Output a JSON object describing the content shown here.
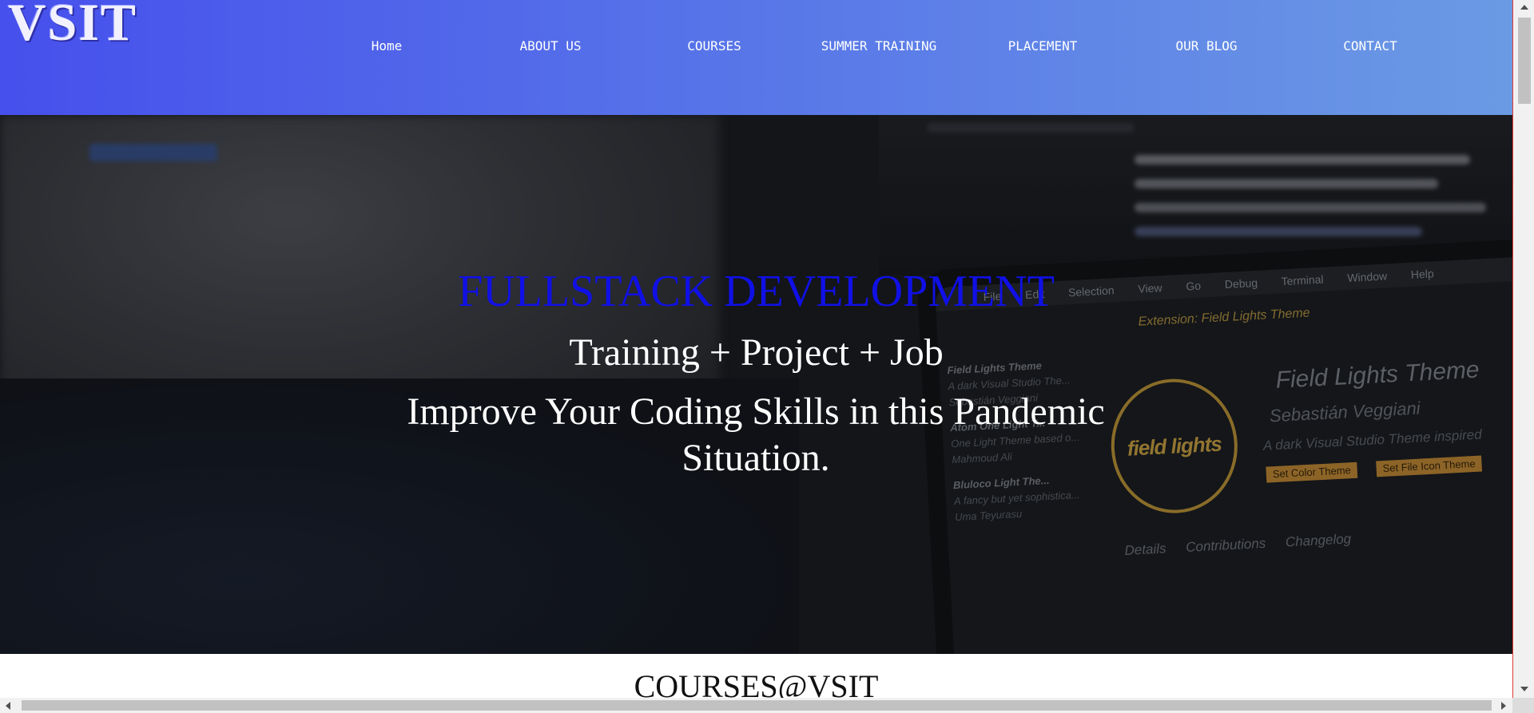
{
  "brand": {
    "logo_text": "VSIT"
  },
  "nav": {
    "items": [
      {
        "label": "Home"
      },
      {
        "label": "ABOUT US"
      },
      {
        "label": "COURSES"
      },
      {
        "label": "SUMMER TRAINING"
      },
      {
        "label": "PLACEMENT"
      },
      {
        "label": "OUR BLOG"
      },
      {
        "label": "CONTACT"
      }
    ]
  },
  "hero": {
    "title": "FULLSTACK DEVELOPMENT",
    "subtitle": "Training + Project + Job",
    "tagline": "Improve Your Coding Skills in this Pandemic Situation.",
    "background_screen": {
      "menu": [
        "File",
        "Edit",
        "Selection",
        "View",
        "Go",
        "Debug",
        "Terminal",
        "Window",
        "Help"
      ],
      "extension_tab": "Extension: Field Lights Theme",
      "logo_text": "field lights",
      "ext_title": "Field Lights Theme",
      "ext_author": "Sebastián Veggiani",
      "ext_desc": "A dark Visual Studio Theme inspired",
      "buttons": [
        "Set Color Theme",
        "Set File Icon Theme"
      ],
      "tabs": [
        "Details",
        "Contributions",
        "Changelog"
      ],
      "sidebar": [
        {
          "name": "Field Lights Theme",
          "desc": "A dark Visual Studio The...",
          "author": "Sebastián Veggiani"
        },
        {
          "name": "Atom One Light T...",
          "desc": "One Light Theme based o...",
          "author": "Mahmoud Ali"
        },
        {
          "name": "Bluloco Light The...",
          "desc": "A fancy but yet sophistica...",
          "author": "Uma Teyurasu"
        }
      ]
    }
  },
  "sections": {
    "courses_heading": "COURSES@VSIT"
  },
  "colors": {
    "navbar_gradient_start": "#4650ec",
    "navbar_gradient_end": "#6b9ae4",
    "hero_title": "#1010e6",
    "hero_text": "#ffffff"
  }
}
